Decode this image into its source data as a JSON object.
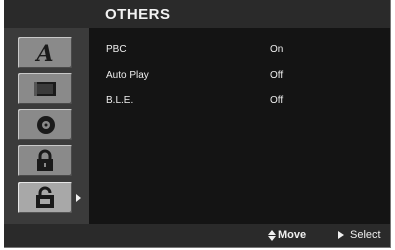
{
  "menu": {
    "title": "OTHERS",
    "tabs": [
      {
        "icon": "language-icon"
      },
      {
        "icon": "display-icon"
      },
      {
        "icon": "audio-icon"
      },
      {
        "icon": "lock-icon"
      },
      {
        "icon": "others-icon",
        "active": true
      }
    ],
    "settings": [
      {
        "name": "PBC",
        "value": "On"
      },
      {
        "name": "Auto Play",
        "value": "Off"
      },
      {
        "name": "B.L.E.",
        "value": "Off"
      }
    ]
  },
  "footer": {
    "move_label": "Move",
    "select_label": "Select"
  }
}
